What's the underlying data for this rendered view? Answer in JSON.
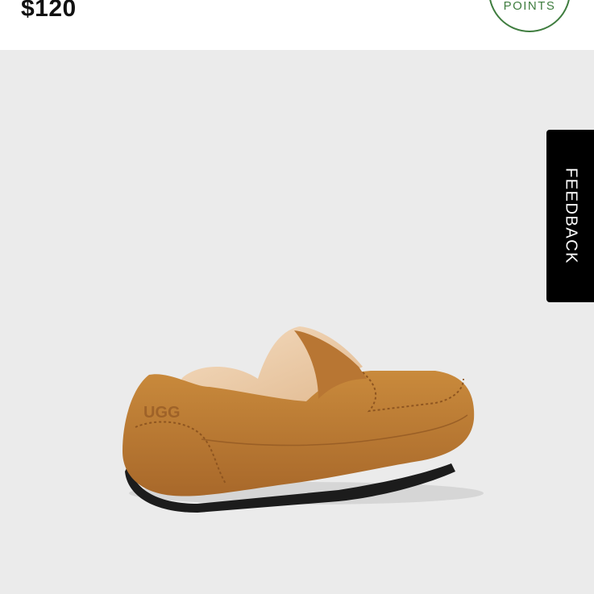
{
  "product": {
    "price": "$120"
  },
  "rewards": {
    "badge_label": "POINTS",
    "color": "#3f7d3f"
  },
  "image": {
    "subject": "tan suede moccasin slipper with shearling lining",
    "background_color": "#ebebeb"
  },
  "feedback": {
    "label": "FEEDBACK"
  }
}
